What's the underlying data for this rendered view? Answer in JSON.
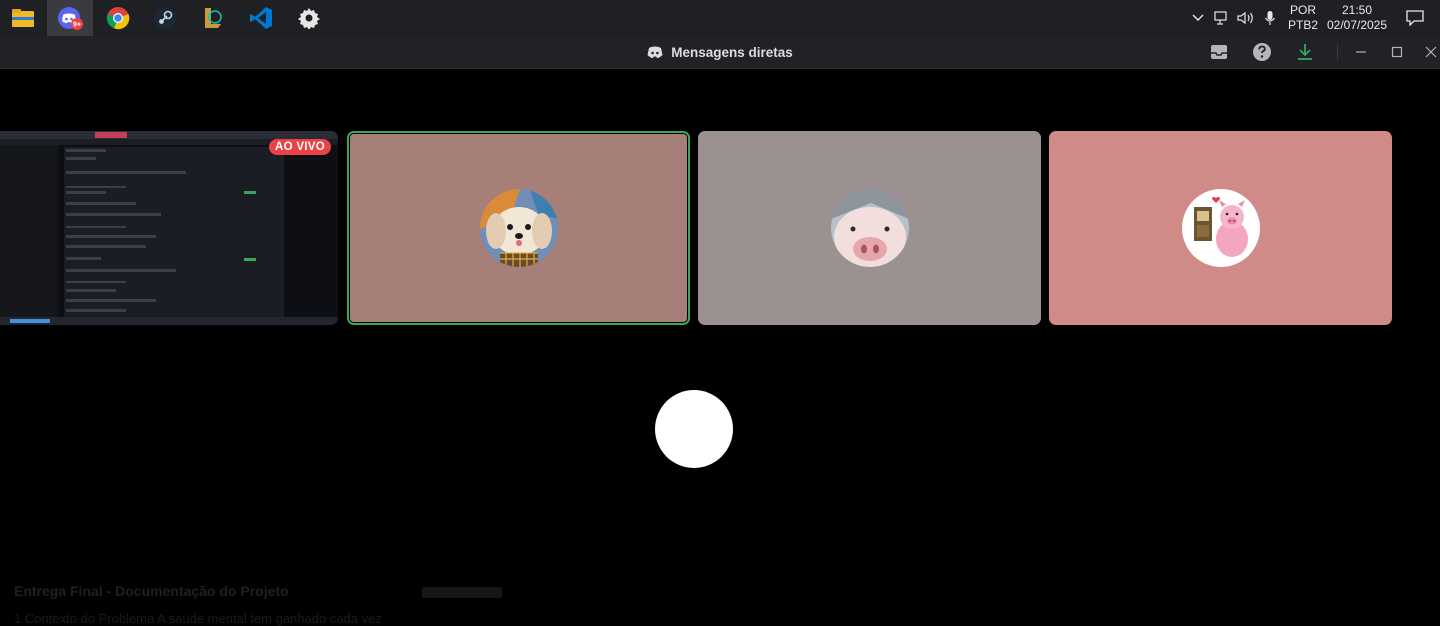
{
  "taskbar": {
    "apps": [
      {
        "name": "file-explorer-icon"
      },
      {
        "name": "discord-icon",
        "badge": "9+"
      },
      {
        "name": "chrome-icon"
      },
      {
        "name": "steam-icon"
      },
      {
        "name": "league-of-legends-icon"
      },
      {
        "name": "vscode-icon"
      },
      {
        "name": "settings-icon"
      }
    ],
    "lang_top": "POR",
    "lang_bottom": "PTB2",
    "time": "21:50",
    "date": "02/07/2025"
  },
  "window": {
    "title": "Mensagens diretas"
  },
  "stage": {
    "live_badge": "AO VIVO",
    "tiles": [
      {
        "kind": "screen-share",
        "speaking": false
      },
      {
        "kind": "avatar",
        "avatar": "dog",
        "speaking": true,
        "bg": "#a67f78"
      },
      {
        "kind": "avatar",
        "avatar": "pig-face",
        "speaking": false,
        "bg": "#9b9191"
      },
      {
        "kind": "avatar",
        "avatar": "cartoon-pig",
        "speaking": false,
        "bg": "#d08a88"
      }
    ],
    "accent_speaking": "#3ba55c",
    "live_color": "#ed4245"
  },
  "background": {
    "doc_title": "Entrega Final - Documentação do Projeto",
    "doc_line": "1 Contexto do Problema A saúde mental tem ganhado cada vez"
  }
}
